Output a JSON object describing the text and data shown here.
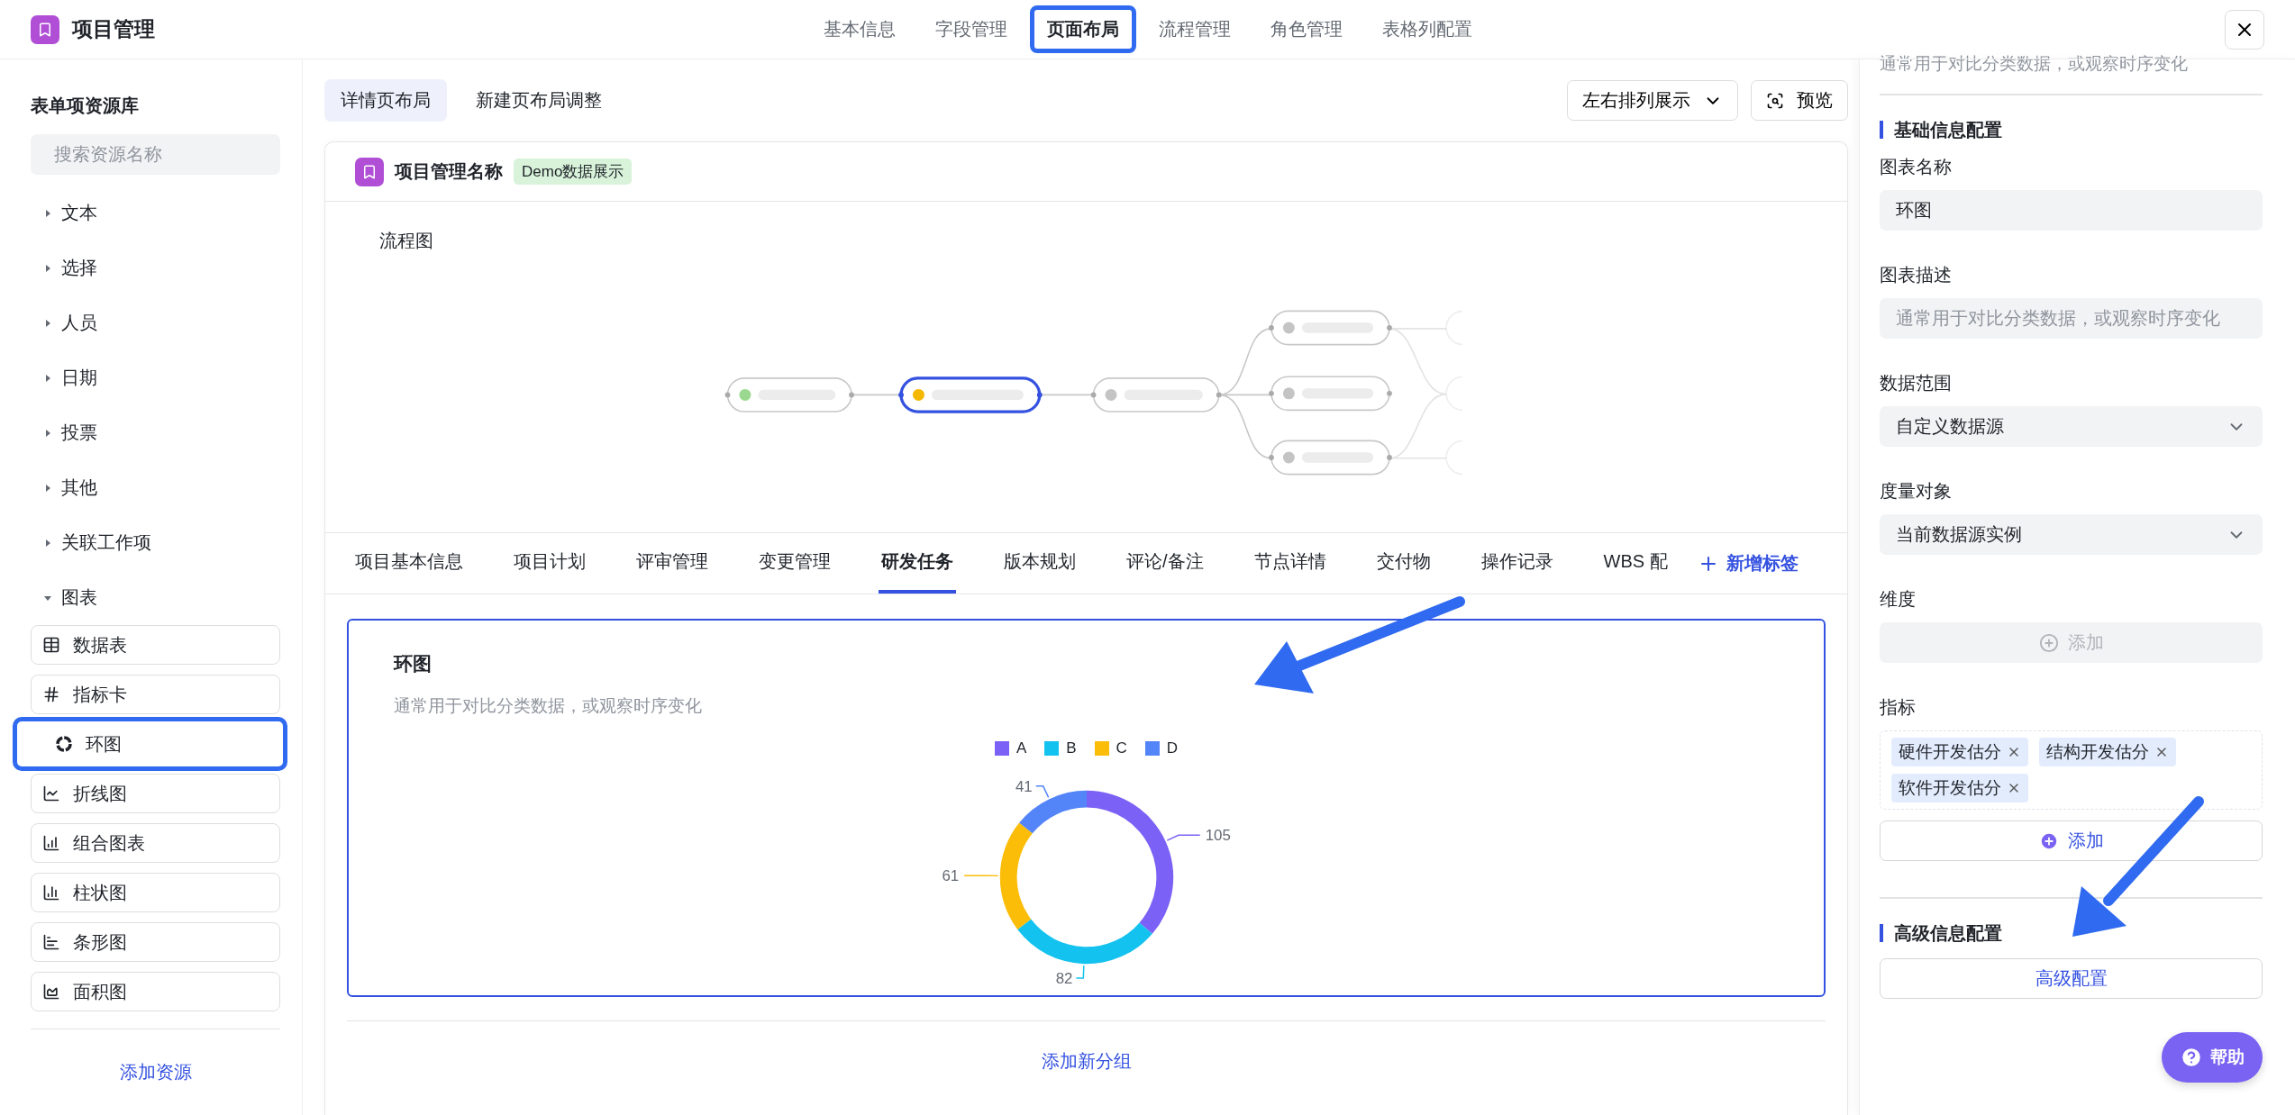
{
  "app": {
    "title": "项目管理"
  },
  "nav_tabs": [
    {
      "label": "基本信息",
      "selected": false
    },
    {
      "label": "字段管理",
      "selected": false
    },
    {
      "label": "页面布局",
      "selected": true
    },
    {
      "label": "流程管理",
      "selected": false
    },
    {
      "label": "角色管理",
      "selected": false
    },
    {
      "label": "表格列配置",
      "selected": false
    }
  ],
  "sidebar": {
    "title": "表单项资源库",
    "search": {
      "placeholder": "搜索资源名称"
    },
    "groups": [
      {
        "label": "文本",
        "expanded": false
      },
      {
        "label": "选择",
        "expanded": false
      },
      {
        "label": "人员",
        "expanded": false
      },
      {
        "label": "日期",
        "expanded": false
      },
      {
        "label": "投票",
        "expanded": false
      },
      {
        "label": "其他",
        "expanded": false
      },
      {
        "label": "关联工作项",
        "expanded": false
      },
      {
        "label": "图表",
        "expanded": true,
        "children": [
          {
            "label": "数据表",
            "highlighted": false
          },
          {
            "label": "指标卡",
            "highlighted": false
          },
          {
            "label": "环图",
            "highlighted": true
          },
          {
            "label": "折线图",
            "highlighted": false
          },
          {
            "label": "组合图表",
            "highlighted": false
          },
          {
            "label": "柱状图",
            "highlighted": false
          },
          {
            "label": "条形图",
            "highlighted": false
          },
          {
            "label": "面积图",
            "highlighted": false
          }
        ]
      }
    ],
    "add_button": "添加资源"
  },
  "layout_tabs": [
    {
      "label": "详情页布局",
      "selected": true
    },
    {
      "label": "新建页布局调整",
      "selected": false
    }
  ],
  "arrangement": {
    "value": "左右排列展示"
  },
  "preview_button": "预览",
  "card": {
    "title": "项目管理名称",
    "badge": "Demo数据展示",
    "flow_title": "流程图",
    "section_tabs": [
      {
        "label": "项目基本信息",
        "selected": false
      },
      {
        "label": "项目计划",
        "selected": false
      },
      {
        "label": "评审管理",
        "selected": false
      },
      {
        "label": "变更管理",
        "selected": false
      },
      {
        "label": "研发任务",
        "selected": true
      },
      {
        "label": "版本规划",
        "selected": false
      },
      {
        "label": "评论/备注",
        "selected": false
      },
      {
        "label": "节点详情",
        "selected": false
      },
      {
        "label": "交付物",
        "selected": false
      },
      {
        "label": "操作记录",
        "selected": false
      },
      {
        "label": "WBS 配",
        "selected": false
      }
    ],
    "add_tab": "新增标签",
    "chart_card": {
      "title": "环图",
      "description": "通常用于对比分类数据，或观察时序变化",
      "chart_data": {
        "type": "donut",
        "categories": [
          "A",
          "B",
          "C",
          "D"
        ],
        "values": [
          105,
          82,
          61,
          41
        ],
        "colors": [
          "#7b61f5",
          "#14c2ef",
          "#fbbd08",
          "#5385f8"
        ],
        "data_labels": true
      }
    },
    "add_group": "添加新分组"
  },
  "panel": {
    "cut_text": "通常用于对比分类数据，或观察时序变化",
    "basic_title": "基础信息配置",
    "fields": [
      {
        "kind": "text",
        "label": "图表名称",
        "value": "环图"
      },
      {
        "kind": "text",
        "label": "图表描述",
        "placeholder": "通常用于对比分类数据，或观察时序变化"
      },
      {
        "kind": "select",
        "label": "数据范围",
        "value": "自定义数据源"
      },
      {
        "kind": "select",
        "label": "度量对象",
        "value": "当前数据源实例"
      },
      {
        "kind": "add",
        "label": "维度",
        "button": "添加",
        "disabled": true
      },
      {
        "kind": "tags",
        "label": "指标",
        "tags": [
          "硬件开发估分",
          "结构开发估分",
          "软件开发估分"
        ],
        "button": "添加",
        "disabled": false
      }
    ],
    "advanced_title": "高级信息配置",
    "advanced_button": "高级配置"
  },
  "help_button": "帮助"
}
